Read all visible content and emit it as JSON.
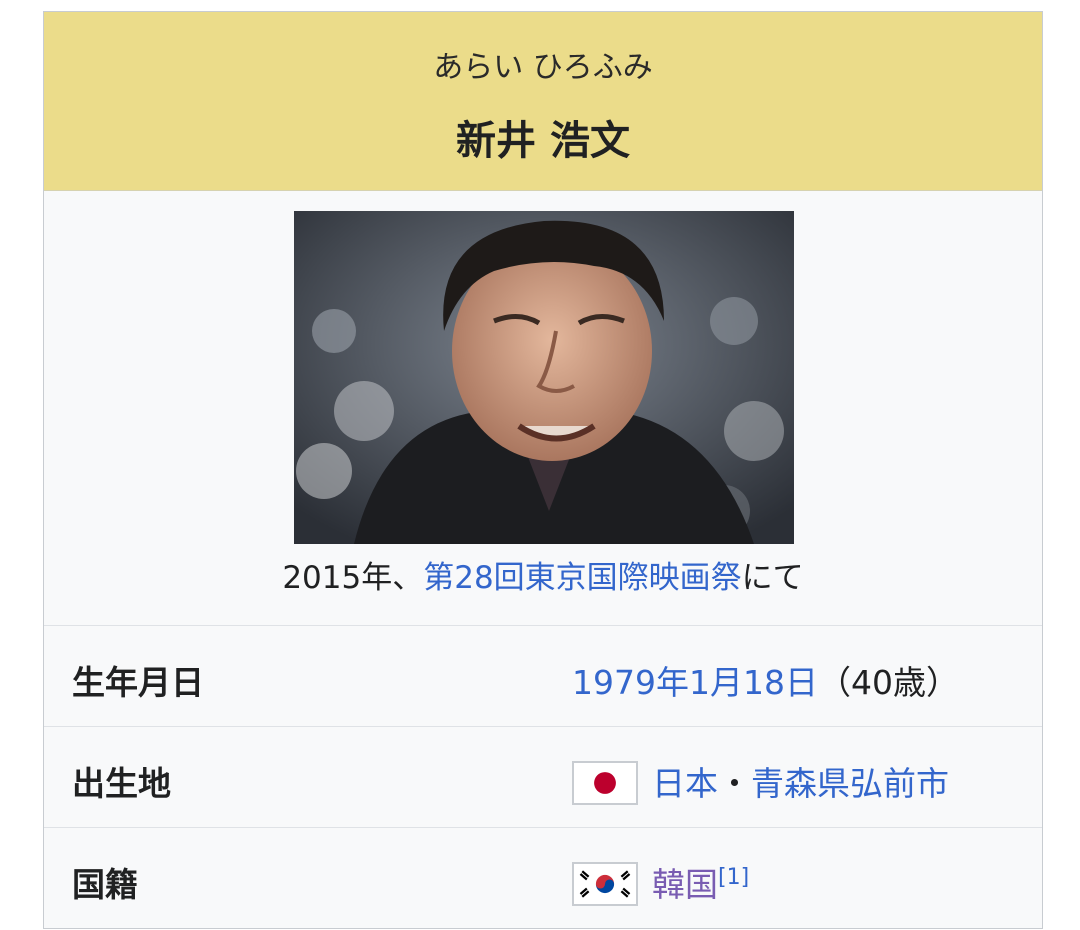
{
  "header": {
    "reading": "あらい ひろふみ",
    "name": "新井 浩文"
  },
  "photo": {
    "alt": "新井 浩文"
  },
  "caption": {
    "prefix": "2015年、",
    "link": "第28回東京国際映画祭",
    "suffix": "にて"
  },
  "rows": {
    "birthdate": {
      "label": "生年月日",
      "date_link": "1979年1月18日",
      "age": "（40歳）"
    },
    "birthplace": {
      "label": "出生地",
      "flag": "japan-flag-icon",
      "country_link": "日本",
      "separator": "・",
      "city_link": "青森県弘前市"
    },
    "nationality": {
      "label": "国籍",
      "flag": "south-korea-flag-icon",
      "country_link": "韓国",
      "ref": "[1]"
    }
  },
  "colors": {
    "header_bg": "#ebdc8a",
    "link": "#3366cc",
    "visited_link": "#795cb2",
    "box_bg": "#f8f9fa"
  }
}
